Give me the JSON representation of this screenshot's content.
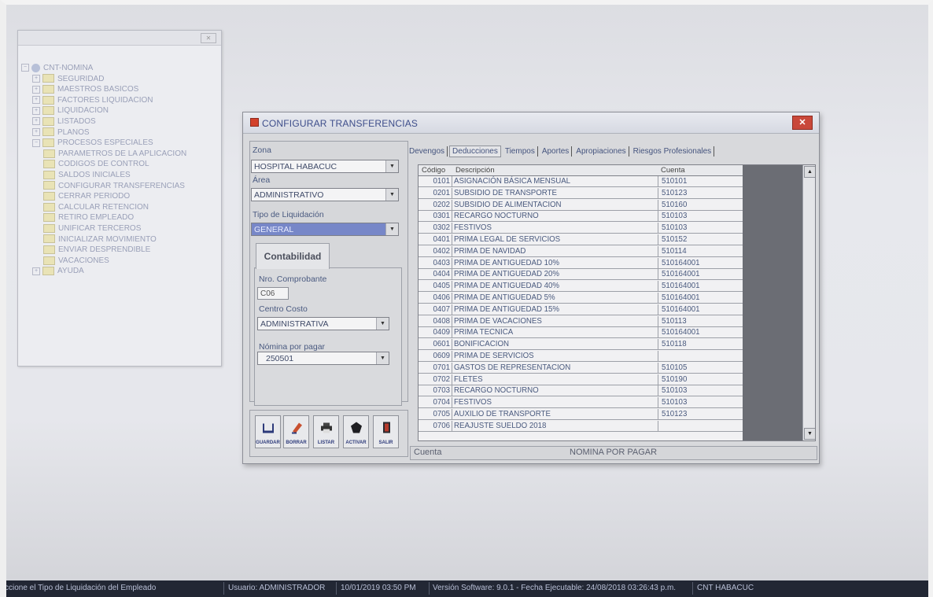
{
  "tree": {
    "items": [
      {
        "label": "CNT-NOMINA",
        "icon": "globe-icon",
        "level": 0
      },
      {
        "label": "SEGURIDAD",
        "icon": "folder-icon",
        "level": 1
      },
      {
        "label": "MAESTROS BASICOS",
        "icon": "folder-icon",
        "level": 1
      },
      {
        "label": "FACTORES LIQUIDACION",
        "icon": "folder-icon",
        "level": 1
      },
      {
        "label": "LIQUIDACION",
        "icon": "folder-icon",
        "level": 1
      },
      {
        "label": "LISTADOS",
        "icon": "folder-icon",
        "level": 1
      },
      {
        "label": "PLANOS",
        "icon": "folder-icon",
        "level": 1
      },
      {
        "label": "PROCESOS ESPECIALES",
        "icon": "folder-icon",
        "level": 1
      },
      {
        "label": "PARAMETROS DE LA APLICACION",
        "icon": "folder-icon",
        "level": 2
      },
      {
        "label": "CODIGOS DE CONTROL",
        "icon": "folder-icon",
        "level": 2
      },
      {
        "label": "SALDOS INICIALES",
        "icon": "folder-icon",
        "level": 2
      },
      {
        "label": "CONFIGURAR TRANSFERENCIAS",
        "icon": "folder-icon",
        "level": 2
      },
      {
        "label": "CERRAR PERIODO",
        "icon": "folder-icon",
        "level": 2
      },
      {
        "label": "CALCULAR RETENCION",
        "icon": "folder-icon",
        "level": 2
      },
      {
        "label": "RETIRO EMPLEADO",
        "icon": "folder-icon",
        "level": 2
      },
      {
        "label": "UNIFICAR TERCEROS",
        "icon": "folder-icon",
        "level": 2
      },
      {
        "label": "INICIALIZAR MOVIMIENTO",
        "icon": "folder-icon",
        "level": 2
      },
      {
        "label": "ENVIAR DESPRENDIBLE",
        "icon": "folder-icon",
        "level": 2
      },
      {
        "label": "VACACIONES",
        "icon": "folder-icon",
        "level": 2
      },
      {
        "label": "AYUDA",
        "icon": "folder-icon",
        "level": 1
      }
    ]
  },
  "dialog": {
    "title": "CONFIGURAR TRANSFERENCIAS",
    "zona_label": "Zona",
    "zona_value": "HOSPITAL HABACUC",
    "area_label": "Área",
    "area_value": "ADMINISTRATIVO",
    "tipo_label": "Tipo de Liquidación",
    "tipo_value": "GENERAL",
    "contabilidad_tab": "Contabilidad",
    "comprobante_label": "Nro. Comprobante",
    "comprobante_value": "C06",
    "centro_label": "Centro  Costo",
    "centro_value": "ADMINISTRATIVA",
    "nomina_label": "Nómina por pagar",
    "nomina_value": "250501",
    "buttons": {
      "guardar": "GUARDAR",
      "borrar": "BORRAR",
      "listar": "LISTAR",
      "activar": "ACTIVAR",
      "salir": "SALIR"
    },
    "tabs": [
      "Devengos",
      "Deducciones",
      "Tiempos",
      "Aportes",
      "Apropiaciones",
      "Riesgos Profesionales"
    ],
    "grid": {
      "headers": {
        "code": "Código",
        "desc": "Descripción",
        "acct": "Cuenta"
      },
      "rows": [
        {
          "code": "0101",
          "desc": "ASIGNACIÓN BÁSICA MENSUAL",
          "acct": "510101"
        },
        {
          "code": "0201",
          "desc": "SUBSIDIO DE TRANSPORTE",
          "acct": "510123"
        },
        {
          "code": "0202",
          "desc": "SUBSIDIO DE ALIMENTACION",
          "acct": "510160"
        },
        {
          "code": "0301",
          "desc": "RECARGO NOCTURNO",
          "acct": "510103"
        },
        {
          "code": "0302",
          "desc": "FESTIVOS",
          "acct": "510103"
        },
        {
          "code": "0401",
          "desc": "PRIMA LEGAL DE SERVICIOS",
          "acct": "510152"
        },
        {
          "code": "0402",
          "desc": "PRIMA DE NAVIDAD",
          "acct": "510114"
        },
        {
          "code": "0403",
          "desc": "PRIMA DE ANTIGUEDAD 10%",
          "acct": "510164001"
        },
        {
          "code": "0404",
          "desc": "PRIMA DE ANTIGUEDAD 20%",
          "acct": "510164001"
        },
        {
          "code": "0405",
          "desc": "PRIMA DE ANTIGUEDAD 40%",
          "acct": "510164001"
        },
        {
          "code": "0406",
          "desc": "PRIMA  DE ANTIGUEDAD 5%",
          "acct": "510164001"
        },
        {
          "code": "0407",
          "desc": "PRIMA  DE ANTIGUEDAD 15%",
          "acct": "510164001"
        },
        {
          "code": "0408",
          "desc": "PRIMA DE VACACIONES",
          "acct": "510113"
        },
        {
          "code": "0409",
          "desc": "PRIMA TECNICA",
          "acct": "510164001"
        },
        {
          "code": "0601",
          "desc": "BONIFICACION",
          "acct": "510118"
        },
        {
          "code": "0609",
          "desc": "PRIMA DE SERVICIOS",
          "acct": ""
        },
        {
          "code": "0701",
          "desc": "GASTOS DE REPRESENTACION",
          "acct": "510105"
        },
        {
          "code": "0702",
          "desc": "FLETES",
          "acct": "510190"
        },
        {
          "code": "0703",
          "desc": "RECARGO NOCTURNO",
          "acct": "510103"
        },
        {
          "code": "0704",
          "desc": "FESTIVOS",
          "acct": "510103"
        },
        {
          "code": "0705",
          "desc": "AUXILIO DE TRANSPORTE",
          "acct": "510123"
        },
        {
          "code": "0706",
          "desc": "REAJUSTE SUELDO 2018",
          "acct": ""
        }
      ]
    },
    "status": {
      "left": "Cuenta",
      "right": "NOMINA POR PAGAR"
    }
  },
  "winbar": {
    "hint": "ccione el Tipo de Liquidación del Empleado",
    "user": "Usuario: ADMINISTRADOR",
    "datetime": "10/01/2019  03:50 PM",
    "version": "Versión Software: 9.0.1  -  Fecha Ejecutable: 24/08/2018 03:26:43 p.m.",
    "company": "CNT  HABACUC"
  }
}
